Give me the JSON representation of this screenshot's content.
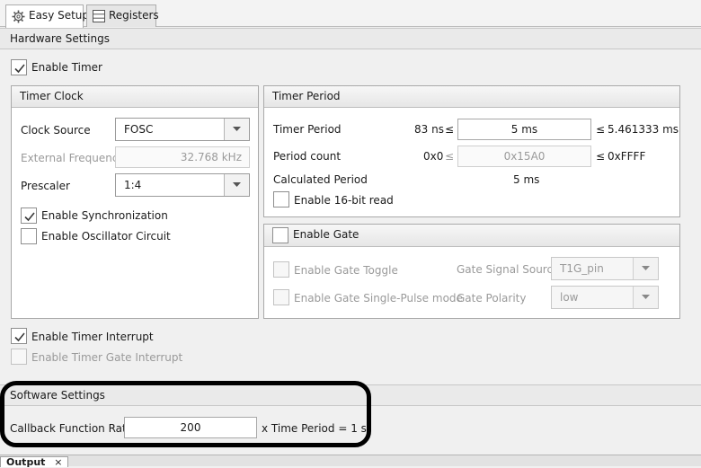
{
  "tabs": [
    {
      "label": "Easy Setup",
      "icon": "gear-icon",
      "active": true
    },
    {
      "label": "Registers",
      "icon": "table-icon",
      "active": false
    }
  ],
  "hardware": {
    "title": "Hardware Settings",
    "enable_timer": {
      "label": "Enable Timer",
      "checked": true
    },
    "timer_clock": {
      "title": "Timer Clock",
      "clock_source_label": "Clock Source",
      "clock_source_value": "FOSC",
      "external_frequency_label": "External Frequency",
      "external_frequency_value": "32.768 kHz",
      "prescaler_label": "Prescaler",
      "prescaler_value": "1:4",
      "enable_synchronization": {
        "label": "Enable Synchronization",
        "checked": true
      },
      "enable_oscillator_circuit": {
        "label": "Enable Oscillator Circuit",
        "checked": false
      }
    },
    "timer_period": {
      "title": "Timer Period",
      "timer_period_label": "Timer Period",
      "timer_period_min": "83 ns",
      "timer_period_value": "5 ms",
      "timer_period_max": "5.461333 ms",
      "period_count_label": "Period count",
      "period_count_min": "0x0",
      "period_count_value": "0x15A0",
      "period_count_max": "0xFFFF",
      "le_symbol": "≤",
      "calculated_period_label": "Calculated Period",
      "calculated_period_value": "5 ms",
      "enable_16bit_read": {
        "label": "Enable 16-bit read",
        "checked": false
      }
    },
    "gate": {
      "title": "Enable Gate",
      "checked": false,
      "enable_gate_toggle": {
        "label": "Enable Gate Toggle",
        "checked": false
      },
      "enable_gate_single_pulse": {
        "label": "Enable Gate Single-Pulse mode",
        "checked": false
      },
      "gate_signal_source_label": "Gate Signal Source",
      "gate_signal_source_value": "T1G_pin",
      "gate_polarity_label": "Gate Polarity",
      "gate_polarity_value": "low"
    },
    "enable_timer_interrupt": {
      "label": "Enable Timer Interrupt",
      "checked": true
    },
    "enable_timer_gate_interrupt": {
      "label": "Enable Timer Gate Interrupt",
      "checked": false
    }
  },
  "software": {
    "title": "Software Settings",
    "callback_label": "Callback Function Rate",
    "callback_value": "200",
    "callback_suffix": "x Time Period = 1 s"
  },
  "output_tab": {
    "label": "Output",
    "close": "×"
  },
  "colors": {
    "highlight_border": "#000000",
    "checkmark": "#3a3a3a"
  }
}
